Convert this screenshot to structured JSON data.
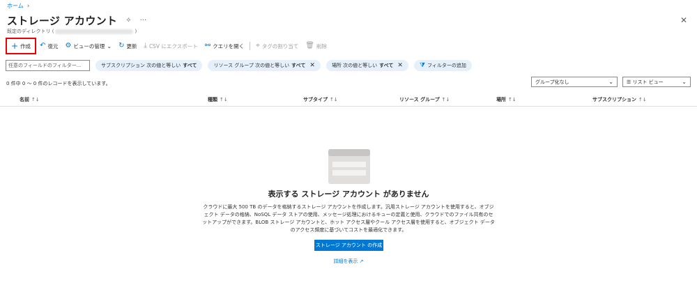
{
  "breadcrumb": {
    "home": "ホーム",
    "sep": "›"
  },
  "header": {
    "title": "ストレージ アカウント",
    "pin_icon": "✧",
    "more_icon": "···",
    "directory_label": "既定のディレクトリ (",
    "directory_close": ")",
    "close_icon": "✕"
  },
  "toolbar": {
    "create": "作成",
    "restore": "復元",
    "manage_view": "ビューの管理",
    "refresh": "更新",
    "export_csv": "CSV にエクスポート",
    "open_query": "クエリを開く",
    "assign_tags": "タグの割り当て",
    "delete": "削除"
  },
  "filters": {
    "placeholder": "任意のフィールドのフィルター...",
    "pills": [
      {
        "name": "サブスクリプション 次の値と等しい",
        "value": "すべて"
      },
      {
        "name": "リソース グループ 次の値と等しい",
        "value": "すべて"
      },
      {
        "name": "場所 次の値と等しい",
        "value": "すべて"
      }
    ],
    "add_filter": "フィルターの追加"
  },
  "records_count": "0 件中 0 ～ 0 件のレコードを表示しています。",
  "group_select": "グループ化なし",
  "view_select": "リスト ビュー",
  "columns": [
    "名前",
    "種類",
    "サブタイプ",
    "リソース グループ",
    "場所",
    "サブスクリプション"
  ],
  "empty_state": {
    "title": "表示する ストレージ アカウント がありません",
    "description": "クラウドに最大 500 TB のデータを格納するストレージ アカウントを作成します。汎用ストレージ アカウントを使用すると、オブジェクト データの格納、NoSQL データ ストアの使用、メッセージ処理におけるキューの定義と使用、クラウドでのファイル共有のセットアップができます。BLOB ストレージ アカウントと、ホット アクセス層やクール アクセス層を使用すると、オブジェクト データのアクセス頻度に基づいてコストを最適化できます。",
    "button": "ストレージ アカウント の作成",
    "learn_more": "詳細を表示"
  },
  "colors": {
    "accent": "#0078d4",
    "pill_bg": "#e6f0fa",
    "highlight": "#ee0000"
  }
}
